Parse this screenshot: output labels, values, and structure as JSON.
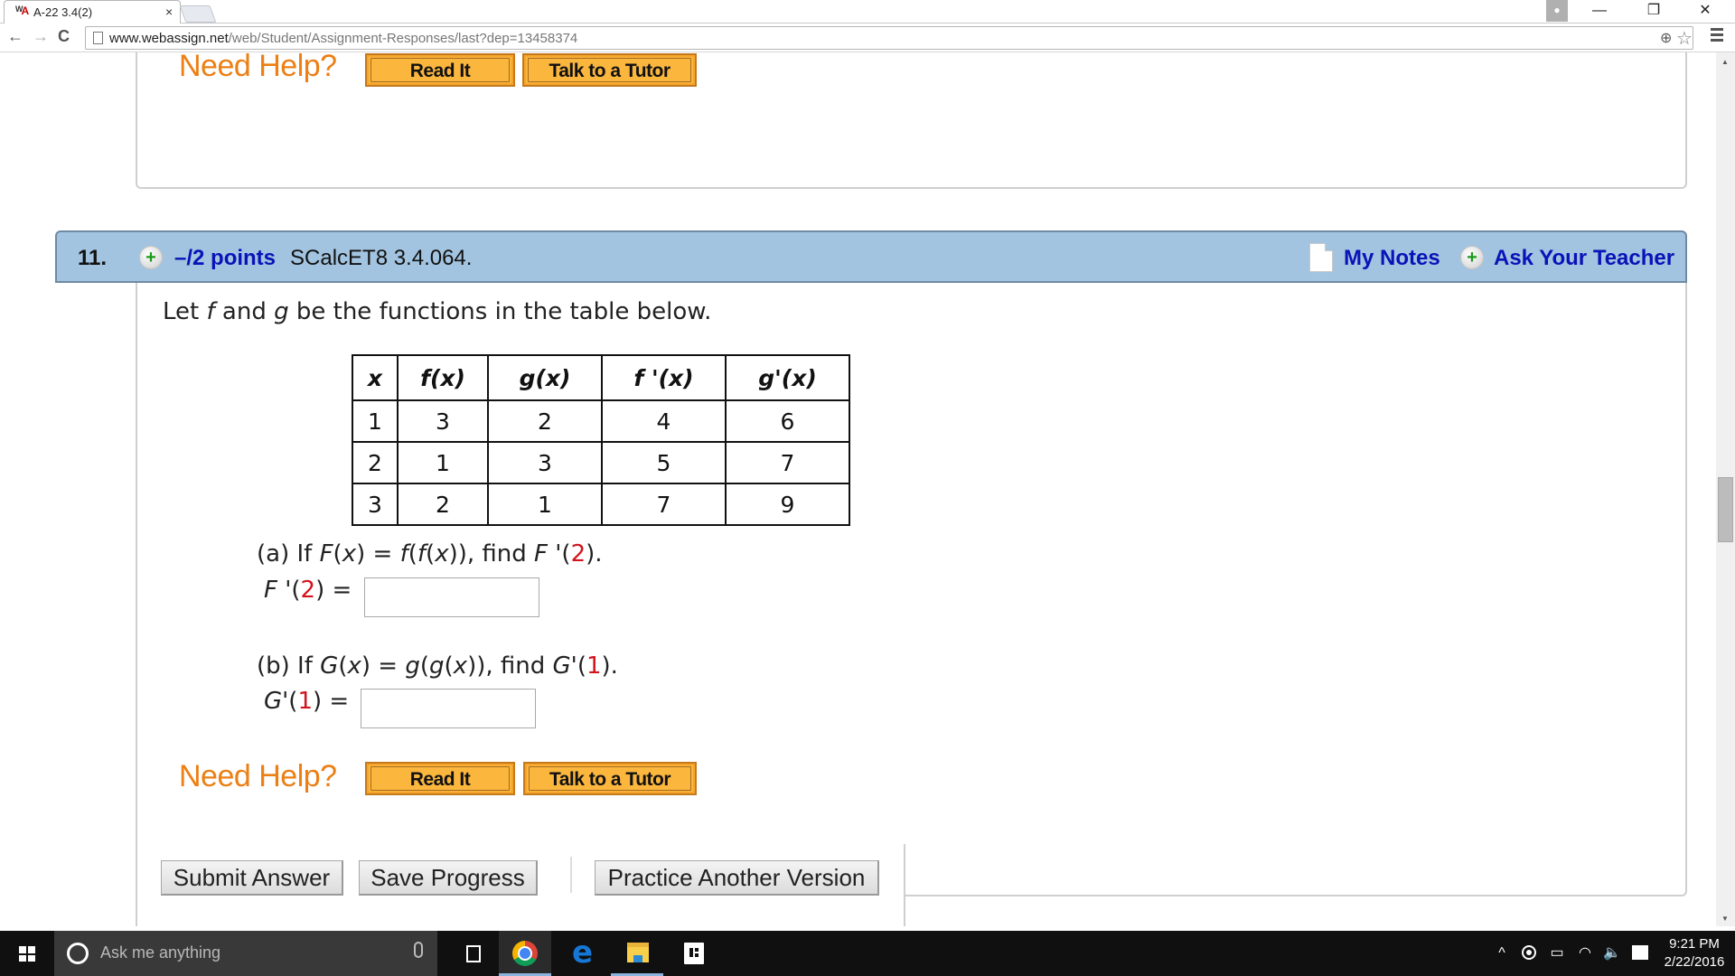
{
  "browser": {
    "tab_title": "A-22 3.4(2)",
    "tab_close": "×",
    "url_host": "www.webassign.net",
    "url_path": "/web/Student/Assignment-Responses/last?dep=13458374",
    "icons": {
      "back": "←",
      "forward": "→",
      "reload": "C",
      "zoom": "⊕",
      "star": "☆",
      "minimize": "—",
      "maximize": "❐",
      "close": "✕",
      "user": "👤"
    }
  },
  "previous_question": {
    "need_help_label": "Need Help?",
    "read_it_label": "Read It",
    "talk_tutor_label": "Talk to a Tutor"
  },
  "question": {
    "number": "11.",
    "points": "–/2 points",
    "code": "SCalcET8 3.4.064.",
    "my_notes_label": "My Notes",
    "ask_teacher_label": "Ask Your Teacher",
    "plus_symbol": "+",
    "colors": {
      "header_bg": "#a2c4e0",
      "link": "#0a12b8",
      "highlight": "#d2141e",
      "help": "#ec7f15"
    },
    "intro": {
      "prefix": "Let ",
      "f": "f",
      "middle": " and ",
      "g": "g",
      "suffix": " be the functions in the table below."
    },
    "table": {
      "headers": [
        "x",
        "f(x)",
        "g(x)",
        "f '(x)",
        "g'(x)"
      ],
      "rows": [
        [
          "1",
          "3",
          "2",
          "4",
          "6"
        ],
        [
          "2",
          "1",
          "3",
          "5",
          "7"
        ],
        [
          "3",
          "2",
          "1",
          "7",
          "9"
        ]
      ]
    },
    "part_a": {
      "q_prefix": "(a) If ",
      "q_func": "F",
      "q_mid1": "(",
      "q_x1": "x",
      "q_mid2": ") = ",
      "q_comp": "f",
      "q_mid3": "(",
      "q_comp2": "f",
      "q_mid4": "(",
      "q_x2": "x",
      "q_mid5": ")), find ",
      "q_target": "F '",
      "q_open": "(",
      "q_value": "2",
      "q_close": ").",
      "label_func": "F '",
      "label_open": "(",
      "label_value": "2",
      "label_close": ") =",
      "answer_value": "",
      "answer_placeholder": ""
    },
    "part_b": {
      "q_prefix": "(b) If ",
      "q_func": "G",
      "q_mid1": "(",
      "q_x1": "x",
      "q_mid2": ") = ",
      "q_comp": "g",
      "q_mid3": "(",
      "q_comp2": "g",
      "q_mid4": "(",
      "q_x2": "x",
      "q_mid5": ")), find ",
      "q_target": "G'",
      "q_open": "(",
      "q_value": "1",
      "q_close": ").",
      "label_func": "G'",
      "label_open": "(",
      "label_value": "1",
      "label_close": ") =",
      "answer_value": "",
      "answer_placeholder": ""
    },
    "need_help_label": "Need Help?",
    "read_it_label": "Read It",
    "talk_tutor_label": "Talk to a Tutor",
    "buttons": {
      "submit": "Submit Answer",
      "save": "Save Progress",
      "practice": "Practice Another Version"
    }
  },
  "taskbar": {
    "search_placeholder": "Ask me anything",
    "tray": {
      "chevron": "^",
      "battery": "▭",
      "wifi": "◠",
      "volume": "🔈"
    },
    "time": "9:21 PM",
    "date": "2/22/2016"
  }
}
